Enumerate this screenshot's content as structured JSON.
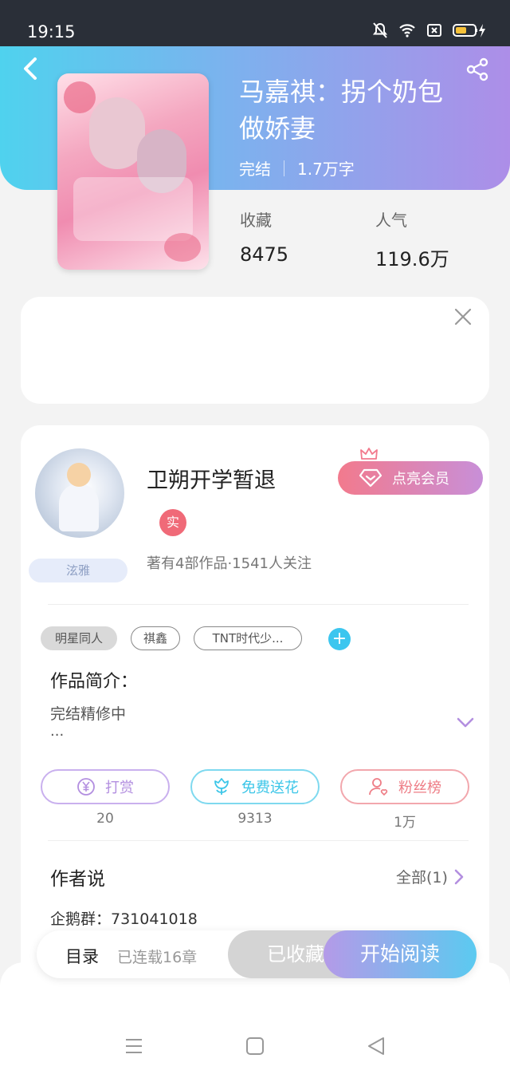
{
  "status_bar": {
    "time": "19:15"
  },
  "book": {
    "title_line1": "马嘉祺：拐个奶包",
    "title_line2": "做娇妻",
    "status": "完结",
    "word_count": "1.7万字",
    "stats": [
      {
        "label": "收藏",
        "value": "8475"
      },
      {
        "label": "人气",
        "value": "119.6万"
      }
    ]
  },
  "author": {
    "name": "卫朔开学暂退",
    "real_badge": "实",
    "nickname_badge": "泫雅",
    "summary": "著有4部作品·1541人关注",
    "vip_button": "点亮会员"
  },
  "tags": [
    "明星同人",
    "祺鑫",
    "TNT时代少..."
  ],
  "intro": {
    "heading": "作品简介：",
    "text": "完结精修中",
    "ellipsis": "..."
  },
  "actions": [
    {
      "label": "打赏",
      "count": "20",
      "color": "#b38fe0"
    },
    {
      "label": "免费送花",
      "count": "9313",
      "color": "#3cc6e8"
    },
    {
      "label": "粉丝榜",
      "count": "1万",
      "color": "#ee7d86"
    }
  ],
  "author_says": {
    "heading": "作者说",
    "all_link": "全部(1)",
    "content": "企鹅群：731041018"
  },
  "bottom_bar": {
    "toc": "目录",
    "serial_info": "已连载16章",
    "collected": "已收藏",
    "read": "开始阅读"
  }
}
